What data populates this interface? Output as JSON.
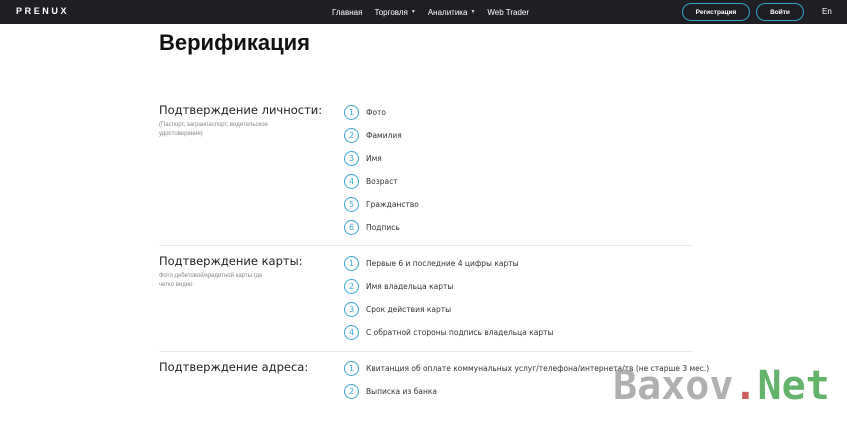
{
  "header": {
    "logo": "PRENUX",
    "nav": [
      {
        "label": "Главная",
        "dropdown": false
      },
      {
        "label": "Торговля",
        "dropdown": true
      },
      {
        "label": "Аналитика",
        "dropdown": true
      },
      {
        "label": "Web Trader",
        "dropdown": false
      }
    ],
    "register_label": "Регистрация",
    "login_label": "Войти",
    "lang": "En",
    "colors": {
      "bar": "#1e1f24",
      "button_border": "#2fa5c8"
    }
  },
  "page": {
    "title": "Верификация"
  },
  "sections": [
    {
      "title": "Подтверждение личности:",
      "desc": "(Паспорт, загранпаспорт, водительское удостоверение)",
      "items": [
        {
          "n": "1",
          "text": "Фото"
        },
        {
          "n": "2",
          "text": "Фамилия"
        },
        {
          "n": "3",
          "text": "Имя"
        },
        {
          "n": "4",
          "text": "Возраст"
        },
        {
          "n": "5",
          "text": "Гражданство"
        },
        {
          "n": "6",
          "text": "Подпись"
        }
      ]
    },
    {
      "title": "Подтверждение карты:",
      "desc": "Фото дебетовой/кредитной карты где четко видно:",
      "items": [
        {
          "n": "1",
          "text": "Первые 6 и последние 4 цифры карты"
        },
        {
          "n": "2",
          "text": "Имя владельца карты"
        },
        {
          "n": "3",
          "text": "Срок действия карты"
        },
        {
          "n": "4",
          "text": "С обратной стороны подпись владельца карты"
        }
      ]
    },
    {
      "title": "Подтверждение адреса:",
      "desc": "",
      "items": [
        {
          "n": "1",
          "text": "Квитанция об оплате коммунальных услуг/телефона/интернета/тв (не старше 3 мес.)"
        },
        {
          "n": "2",
          "text": "Выписка из банка"
        }
      ]
    }
  ],
  "watermark": {
    "part1": "Baxov",
    "part2": ".",
    "part3": "Net"
  },
  "accent_color": "#3aa7d6"
}
